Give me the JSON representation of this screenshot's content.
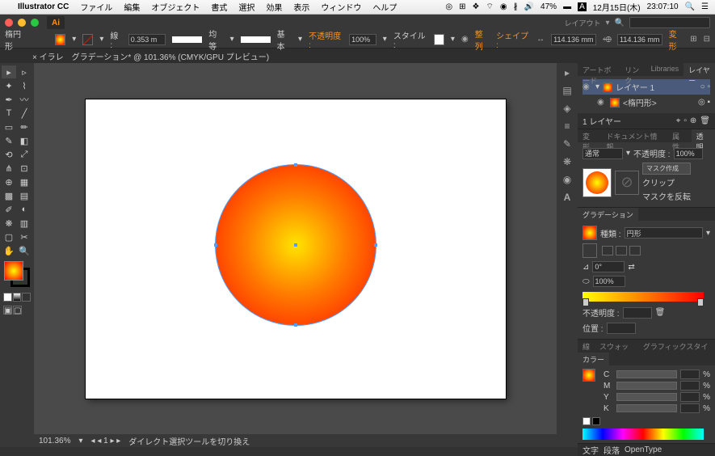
{
  "menubar": {
    "app": "Illustrator CC",
    "items": [
      "ファイル",
      "編集",
      "オブジェクト",
      "書式",
      "選択",
      "効果",
      "表示",
      "ウィンドウ",
      "ヘルプ"
    ],
    "battery": "47%",
    "date": "12月15日(木)",
    "time": "23:07:10"
  },
  "titlebar": {
    "ai": "Ai",
    "layout": "レイアウト"
  },
  "optbar": {
    "shape": "楕円形",
    "stroke_lbl": "線 :",
    "stroke_w": "0.353 m",
    "uniform": "均等",
    "basic": "基本",
    "opacity_lbl": "不透明度 :",
    "opacity_val": "100%",
    "style_lbl": "スタイル :",
    "align": "整列",
    "shape_btn": "シェイプ :",
    "w": "114.136 mm",
    "h": "114.136 mm",
    "transform": "変形"
  },
  "tab": "× イラレ　グラデーション* @ 101.36% (CMYK/GPU プレビュー)",
  "statusbar": {
    "zoom": "101.36%",
    "tool": "ダイレクト選択ツールを切り換え"
  },
  "layers": {
    "tabs": [
      "アートボード",
      "リンク",
      "Libraries",
      "レイヤー"
    ],
    "layer1": "レイヤー 1",
    "obj": "<楕円形>",
    "footer": "1 レイヤー"
  },
  "transparency": {
    "tabs": [
      "変形",
      "ドキュメント情報",
      "属性",
      "透明"
    ],
    "mode": "通常",
    "op_lbl": "不透明度 :",
    "op_val": "100%",
    "mask": "マスク作成",
    "clip": "クリップ",
    "invert": "マスクを反転"
  },
  "gradient": {
    "title": "グラデーション",
    "type_lbl": "種類 :",
    "type_val": "円形",
    "angle": "0°",
    "ratio": "100%",
    "op_lbl": "不透明度 :",
    "pos_lbl": "位置 :"
  },
  "swatch_tabs": [
    "線",
    "スウォッチ",
    "グラフィックスタイル"
  ],
  "color": {
    "title": "カラー",
    "c": "C",
    "m": "M",
    "y": "Y",
    "k": "K",
    "pct": "%"
  },
  "footer": {
    "char": "文字",
    "para": "段落",
    "ot": "OpenType"
  },
  "chart_data": {
    "type": "radial-gradient",
    "shape": "ellipse",
    "width_mm": 114.136,
    "height_mm": 114.136,
    "stops": [
      {
        "position": 0,
        "color": "#ffe400"
      },
      {
        "position": 100,
        "color": "#e92000"
      }
    ]
  }
}
